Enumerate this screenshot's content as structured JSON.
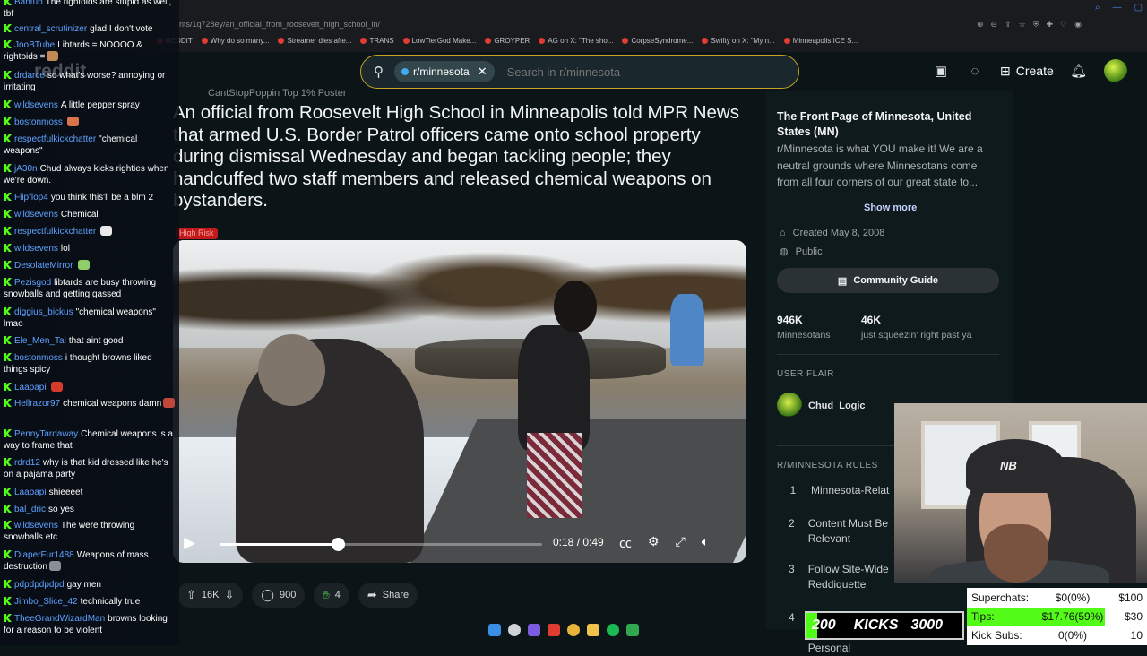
{
  "browser": {
    "url": "nts/1q728ey/an_official_from_roosevelt_high_school_in/",
    "bookmarks": [
      "REDDIT",
      "Why do so many...",
      "Streamer dies afte...",
      "TRANS",
      "LowTierGod Make...",
      "GROYPER",
      "AG on X: \"The sho...",
      "CorpseSyndrome...",
      "Swifty on X: \"My n...",
      "Minneapolis ICE S..."
    ]
  },
  "header": {
    "logo": "reddit",
    "subreddit_chip": "r/minnesota",
    "search_placeholder": "Search in r/minnesota",
    "create_label": "Create"
  },
  "post": {
    "author": "CantStopPoppin   Top 1% Poster",
    "title": "An official from Roosevelt High School in Minneapolis told MPR News that armed U.S. Border Patrol officers came onto school property during dismissal Wednesday and began tackling people; they handcuffed two staff members and released chemical weapons on bystanders.",
    "badge": "High Risk",
    "video": {
      "time": "0:18 / 0:49",
      "progress_fraction": 0.367
    },
    "actions": {
      "votes": "16K",
      "comments": "900",
      "awards": "4",
      "share": "Share"
    }
  },
  "sidebar": {
    "title": "The Front Page of Minnesota, United States (MN)",
    "description": "r/Minnesota is what YOU make it! We are a neutral grounds where Minnesotans come from all four corners of our great state to...",
    "show_more": "Show more",
    "created": "Created May 8, 2008",
    "visibility": "Public",
    "community_guide": "Community Guide",
    "stats": [
      {
        "value": "946K",
        "label": "Minnesotans"
      },
      {
        "value": "46K",
        "label": "just squeezin' right past ya"
      }
    ],
    "flair_heading": "USER FLAIR",
    "flair_name": "Chud_Logic",
    "rules_heading": "R/MINNESOTA RULES",
    "rules": [
      {
        "num": "1",
        "text": "Minnesota-Relat"
      },
      {
        "num": "2",
        "text": "Content Must Be Relevant"
      },
      {
        "num": "3",
        "text": "Follow Site-Wide Reddiquette"
      },
      {
        "num": "4",
        "text": "No Discrimination or Personal"
      }
    ]
  },
  "chat": {
    "watermark": "reddit",
    "messages": [
      {
        "user": "Bantub",
        "color": "#5ea1ff",
        "text": "The rightoids are stupid as well, tbf"
      },
      {
        "user": "central_scrutinizer",
        "color": "#5ea1ff",
        "text": "glad I don't vote"
      },
      {
        "user": "JooBTube",
        "color": "#5ea1ff",
        "text": "Libtards = NOOOO & rightoids ="
      },
      {
        "user": "drdarce",
        "color": "#5ea1ff",
        "text": "so what's worse? annoying or irritating"
      },
      {
        "user": "wildsevens",
        "color": "#5ea1ff",
        "text": "A little pepper spray"
      },
      {
        "user": "bostonmoss",
        "color": "#5ea1ff",
        "text": ""
      },
      {
        "user": "respectfulkickchatter",
        "color": "#5ea1ff",
        "text": "\"chemical weapons\""
      },
      {
        "user": "jA30n",
        "color": "#5ea1ff",
        "text": "Chud always kicks righties when we're down."
      },
      {
        "user": "Flipflop4",
        "color": "#5ea1ff",
        "text": "you think this'll be a blm 2"
      },
      {
        "user": "wildsevens",
        "color": "#5ea1ff",
        "text": "Chemical"
      },
      {
        "user": "respectfulkickchatter",
        "color": "#5ea1ff",
        "text": ""
      },
      {
        "user": "wildsevens",
        "color": "#5ea1ff",
        "text": "lol"
      },
      {
        "user": "DesolateMirror",
        "color": "#5ea1ff",
        "text": ""
      },
      {
        "user": "Pezisgod",
        "color": "#5ea1ff",
        "text": "libtards are busy throwing snowballs and getting gassed"
      },
      {
        "user": "diggius_bickus",
        "color": "#5ea1ff",
        "text": "\"chemical weapons\" lmao"
      },
      {
        "user": "Ele_Men_Tal",
        "color": "#5ea1ff",
        "text": "that aint good"
      },
      {
        "user": "bostonmoss",
        "color": "#5ea1ff",
        "text": "i thought browns liked things spicy"
      },
      {
        "user": "Laapapi",
        "color": "#5ea1ff",
        "text": ""
      },
      {
        "user": "Hellrazor97",
        "color": "#5ea1ff",
        "text": "chemical weapons damn"
      },
      {
        "user": "PennyTardaway",
        "color": "#5ea1ff",
        "text": "Chemical weapons is a way to frame that"
      },
      {
        "user": "rdrd12",
        "color": "#5ea1ff",
        "text": "why is that kid dressed like he's on a pajama party"
      },
      {
        "user": "Laapapi",
        "color": "#5ea1ff",
        "text": "shieeeet"
      },
      {
        "user": "bal_dric",
        "color": "#5ea1ff",
        "text": "so yes"
      },
      {
        "user": "wildsevens",
        "color": "#5ea1ff",
        "text": "The were throwing snowballs etc"
      },
      {
        "user": "DiaperFur1488",
        "color": "#5ea1ff",
        "text": "Weapons of mass destruction"
      },
      {
        "user": "pdpdpdpdpd",
        "color": "#5ea1ff",
        "text": "gay men"
      },
      {
        "user": "Jimbo_Slice_42",
        "color": "#5ea1ff",
        "text": "technically true"
      },
      {
        "user": "TheeGrandWizardMan",
        "color": "#5ea1ff",
        "text": "browns looking for a reason to be violent"
      }
    ]
  },
  "goal": {
    "current": "200",
    "label": "KICKS",
    "target": "3000",
    "fraction": 0.0667
  },
  "tips": [
    {
      "label": "Superchats:",
      "value": "$0(0%)",
      "total": "$100",
      "fraction": 0
    },
    {
      "label": "Tips:",
      "value": "$17.76(59%)",
      "total": "$30",
      "fraction": 0.59
    },
    {
      "label": "Kick Subs:",
      "value": "0(0%)",
      "total": "10",
      "fraction": 0
    }
  ],
  "colors": {
    "accent_green": "#53fc18",
    "search_border": "#c9a227",
    "chat_username": "#5ea1ff"
  }
}
